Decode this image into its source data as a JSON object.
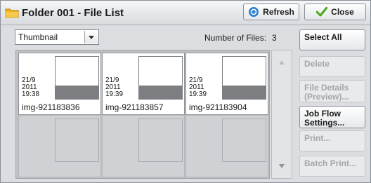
{
  "title": "Folder 001 - File List",
  "toolbar": {
    "refresh_label": "Refresh",
    "close_label": "Close"
  },
  "view_select": {
    "value": "Thumbnail"
  },
  "files_count": {
    "label": "Number of Files:",
    "value": "3"
  },
  "files": [
    {
      "date_line1": "21/9",
      "date_line2": "2011",
      "time": "19:38",
      "name": "img-921183836"
    },
    {
      "date_line1": "21/9",
      "date_line2": "2011",
      "time": "19:39",
      "name": "img-921183857"
    },
    {
      "date_line1": "21/9",
      "date_line2": "2011",
      "time": "19:39",
      "name": "img-921183904"
    }
  ],
  "side_buttons": {
    "select_all": "Select All",
    "delete": "Delete",
    "file_details": "File Details (Preview)...",
    "job_flow": "Job Flow Settings...",
    "print": "Print...",
    "batch_print": "Batch Print..."
  },
  "icons": {
    "title": "folder-icon",
    "refresh": "refresh-icon",
    "close": "checkmark-icon",
    "dropdown": "chevron-down-icon",
    "scroll_up": "arrow-up-icon",
    "scroll_down": "arrow-down-icon"
  },
  "colors": {
    "folder": "#f2b21e",
    "refresh": "#2f7fcf",
    "check": "#49a818",
    "disabled_text": "#a3a6aa"
  }
}
